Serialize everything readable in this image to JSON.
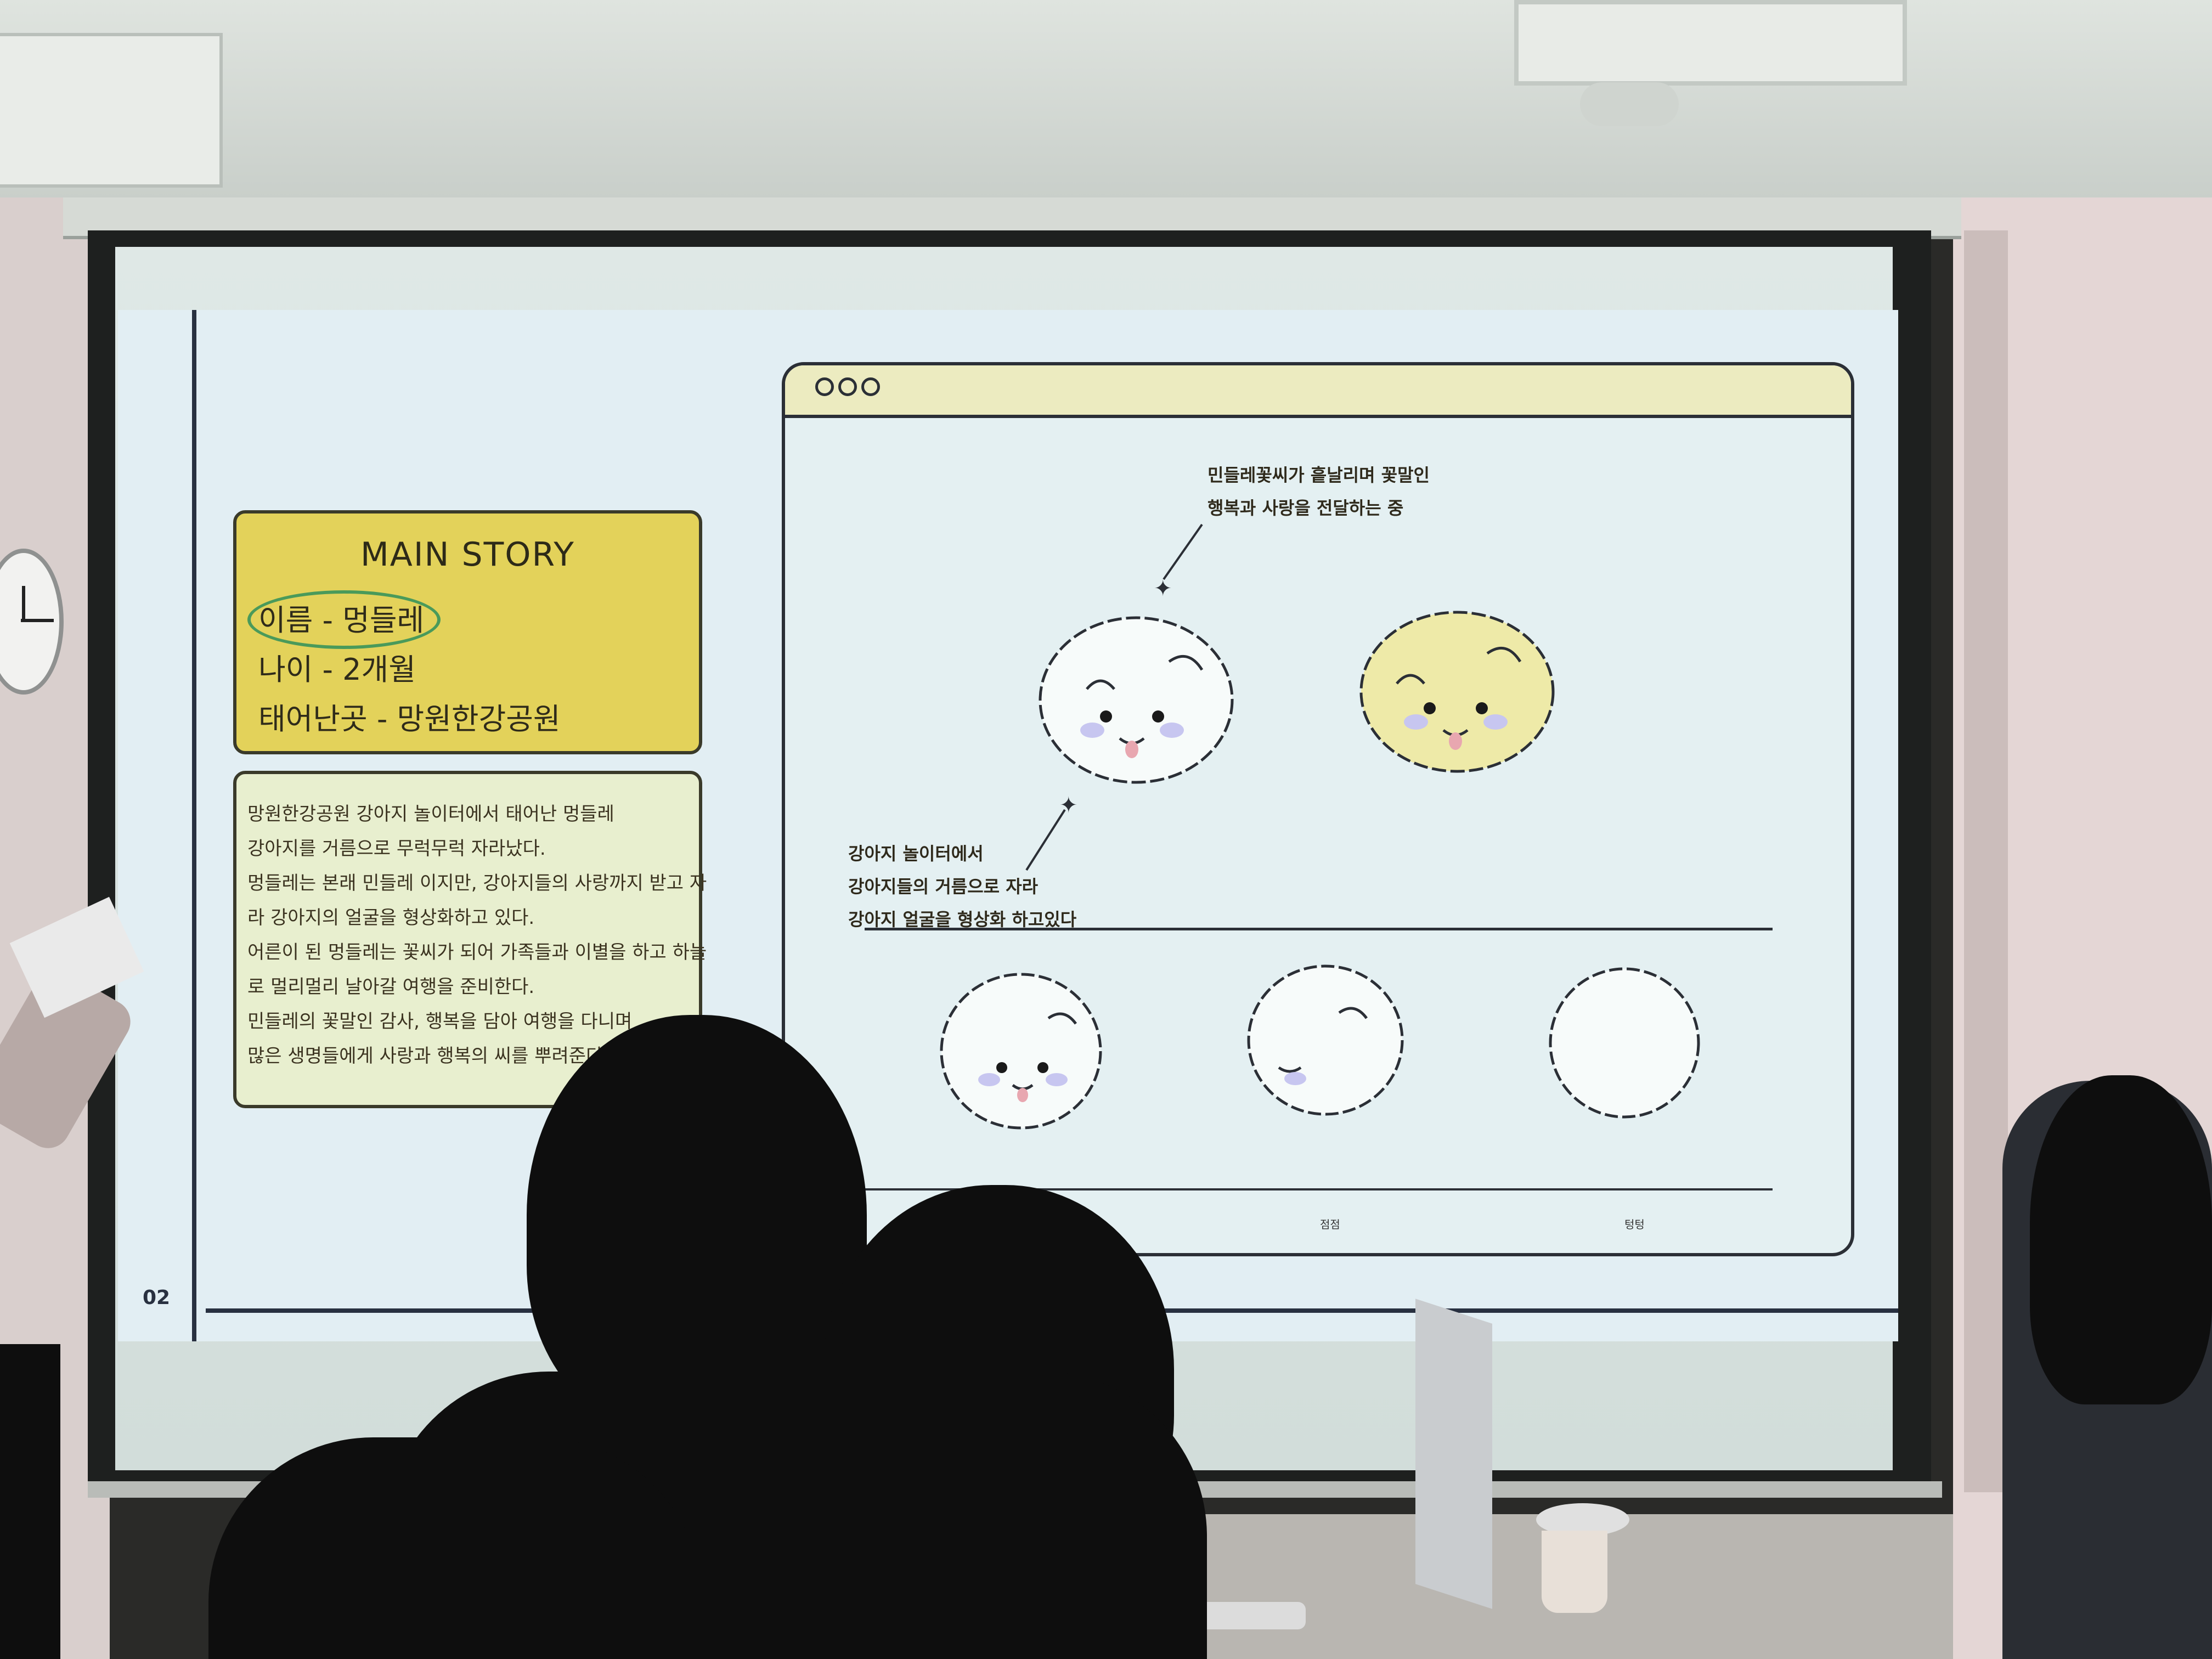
{
  "slide": {
    "page_number": "02",
    "main_story": {
      "title": "MAIN STORY",
      "lines": [
        "이름 - 멍들레",
        "나이 - 2개월",
        "태어난곳 - 망원한강공원"
      ]
    },
    "description": {
      "lines": [
        "망원한강공원 강아지 놀이터에서 태어난 멍들레",
        "강아지를 거름으로 무럭무럭 자라났다.",
        "멍들레는 본래 민들레 이지만, 강아지들의 사랑까지 받고 자",
        "라 강아지의 얼굴을 형상화하고 있다.",
        "어른이 된 멍들레는 꽃씨가 되어 가족들과 이별을 하고 하늘",
        "로 멀리멀리 날아갈 여행을 준비한다.",
        "민들레의 꽃말인 감사, 행복을 담아 여행을 다니며",
        "많은 생명들에게 사랑과 행복의 씨를 뿌려준다."
      ]
    },
    "window": {
      "note_top": [
        "민들레꽃씨가 흩날리며 꽃말인",
        "행복과 사랑을 전달하는 중"
      ],
      "note_bottom": [
        "강아지 놀이터에서",
        "강아지들의 거름으로 자라",
        "강아지 얼굴을 형상화 하고있다"
      ],
      "captions": [
        "점점",
        "텅텅"
      ]
    }
  },
  "colors": {
    "slide_bg": "#e2eef3",
    "card_yellow": "#e3d25a",
    "card_pale": "#e8efcf",
    "window_bar": "#ecebc0",
    "outline": "#2b2f36"
  }
}
